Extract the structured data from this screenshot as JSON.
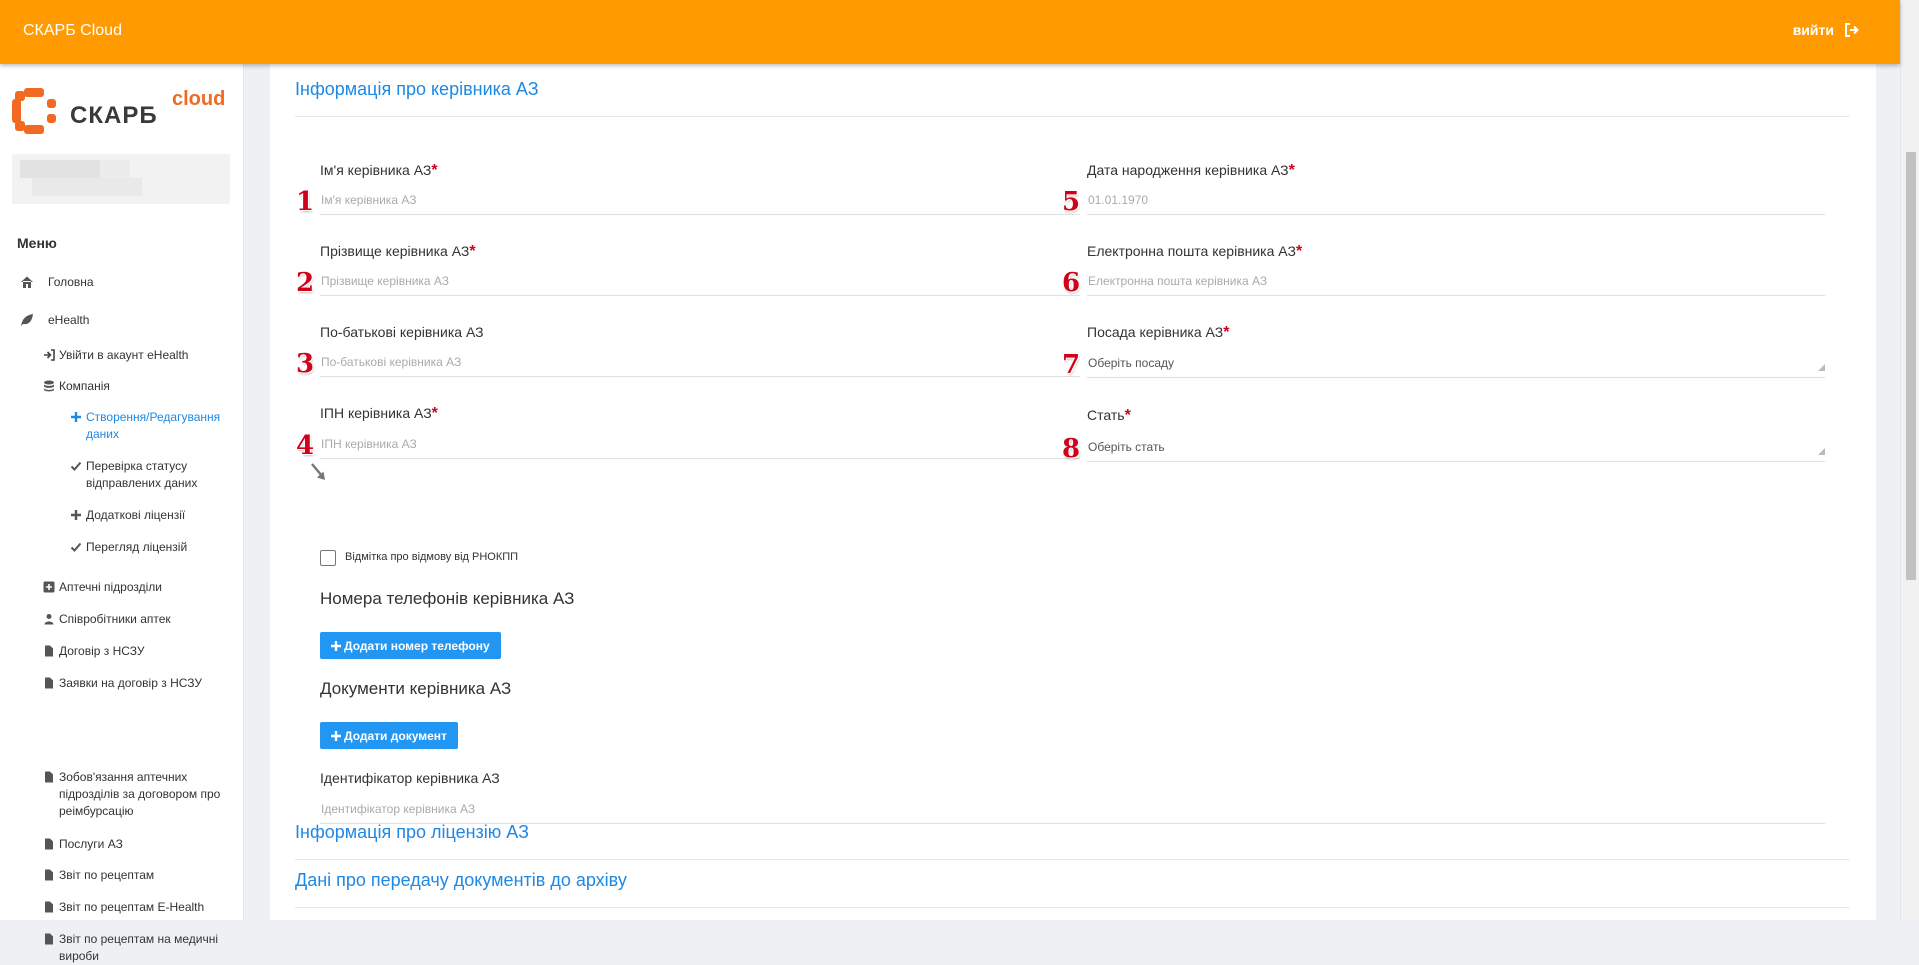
{
  "header": {
    "brand": "СКАРБ Cloud",
    "logout_label": "вийти"
  },
  "sidebar": {
    "logo_text": "СКАРБ",
    "logo_sup": "cloud",
    "menu_title": "Меню",
    "items": [
      {
        "label": "Головна",
        "icon": "home-icon"
      },
      {
        "label": "eHealth",
        "icon": "leaf-icon"
      },
      {
        "label": "Увійти в акаунт eHealth",
        "icon": "sign-in-icon"
      },
      {
        "label": "Компанія",
        "icon": "database-icon"
      },
      {
        "label": "Створення/Редагування даних",
        "icon": "plus-icon",
        "active": true
      },
      {
        "label": "Перевірка статусу відправлених даних",
        "icon": "check-icon"
      },
      {
        "label": "Додаткові ліцензії",
        "icon": "plus-icon"
      },
      {
        "label": "Перегляд ліцензій",
        "icon": "check-icon"
      },
      {
        "label": "Аптечні підрозділи",
        "icon": "plus-square-icon"
      },
      {
        "label": "Співробітники аптек",
        "icon": "user-icon"
      },
      {
        "label": "Договір з НСЗУ",
        "icon": "file-icon"
      },
      {
        "label": "Заявки на договір з НСЗУ",
        "icon": "file-icon"
      },
      {
        "label": "Зобов'язання аптечних підрозділів за договором про реімбурсацію",
        "icon": "file-icon"
      },
      {
        "label": "Послуги АЗ",
        "icon": "file-icon"
      },
      {
        "label": "Звіт по рецептам",
        "icon": "file-icon"
      },
      {
        "label": "Звіт по рецептам E-Health",
        "icon": "file-icon"
      },
      {
        "label": "Звіт по рецептам на медичні вироби",
        "icon": "file-icon"
      }
    ]
  },
  "main": {
    "section_title": "Інформація про керівника АЗ",
    "fields": {
      "first_name": {
        "label": "Ім'я керівника АЗ",
        "placeholder": "Ім'я керівника АЗ",
        "num": "1"
      },
      "last_name": {
        "label": "Прізвище керівника АЗ",
        "placeholder": "Прізвище керівника АЗ",
        "num": "2"
      },
      "middle_name": {
        "label": "По-батькові керівника АЗ",
        "placeholder": "По-батькові керівника АЗ",
        "num": "3"
      },
      "tax_id": {
        "label": "ІПН керівника АЗ",
        "placeholder": "ІПН керівника АЗ",
        "num": "4"
      },
      "birth_date": {
        "label": "Дата народження керівника АЗ",
        "placeholder": "01.01.1970",
        "num": "5"
      },
      "email": {
        "label": "Електронна пошта керівника АЗ",
        "placeholder": "Електронна пошта керівника АЗ",
        "num": "6"
      },
      "position": {
        "label": "Посада керівника АЗ",
        "value": "Оберіть посаду",
        "num": "7"
      },
      "gender": {
        "label": "Стать",
        "value": "Оберіть стать",
        "num": "8"
      }
    },
    "req_mark": "*",
    "refusal_checkbox_label": "Відмітка про відмову від РНОКПП",
    "phones_title": "Номера телефонів керівника АЗ",
    "add_phone_label": "Додати номер телефону",
    "documents_title": "Документи керівника АЗ",
    "add_document_label": "Додати документ",
    "identifier": {
      "label": "Ідентифікатор керівника АЗ",
      "placeholder": "Ідентифікатор керівника АЗ"
    },
    "license_section_title": "Інформація про ліцензію АЗ",
    "archive_section_title": "Дані про передачу документів до архіву"
  },
  "colors": {
    "topbar": "#ff9b00",
    "accent": "#1e88e5",
    "button": "#2196f3",
    "required": "#d0021b"
  }
}
